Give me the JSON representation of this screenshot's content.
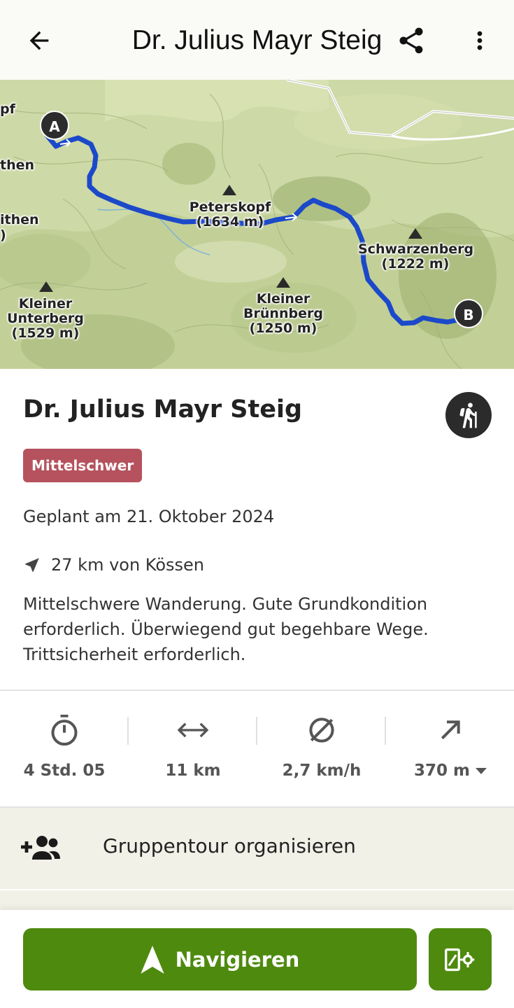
{
  "appbar": {
    "title": "Dr. Julius Mayr Steig",
    "back_icon": "arrow-left-icon",
    "share_icon": "share-icon",
    "more_icon": "more-vert-icon"
  },
  "map": {
    "labels": {
      "peterskopf": "Peterskopf\n(1634 m)",
      "schwarzenberg": "Schwarzenberg\n(1222 m)",
      "kleiner_unterberg": "Kleiner\nUnterberg\n(1529 m)",
      "kleiner_brunnberg": "Kleiner\nBrünnberg\n(1250 m)",
      "edge_pf": "pf",
      "edge_then": "then",
      "edge_ithen": "ithen",
      "edge_paren": ")"
    },
    "start_marker": "A",
    "end_marker": "B",
    "route_color": "#1b49c9"
  },
  "tour": {
    "title": "Dr. Julius Mayr Steig",
    "activity_icon": "hiking-icon",
    "difficulty": "Mittelschwer",
    "difficulty_color": "#b5525e",
    "planned": "Geplant am 21. Oktober 2024",
    "distance_from": "27 km von Kössen",
    "description": "Mittelschwere Wanderung. Gute Grundkondition erforderlich. Überwiegend gut begehbare Wege. Trittsicherheit erforderlich."
  },
  "stats": [
    {
      "icon": "stopwatch-icon",
      "value": "4 Std. 05"
    },
    {
      "icon": "horizontal-arrows-icon",
      "value": "11 km"
    },
    {
      "icon": "average-speed-icon",
      "value": "2,7 km/h"
    },
    {
      "icon": "ascent-arrow-icon",
      "value": "370 m"
    }
  ],
  "group": {
    "icon": "group-add-icon",
    "label": "Gruppentour organisieren"
  },
  "bottom": {
    "navigate_label": "Navigieren",
    "navigate_icon": "navigation-arrow-icon",
    "side_icon": "route-settings-icon",
    "accent": "#4e8a0e"
  }
}
